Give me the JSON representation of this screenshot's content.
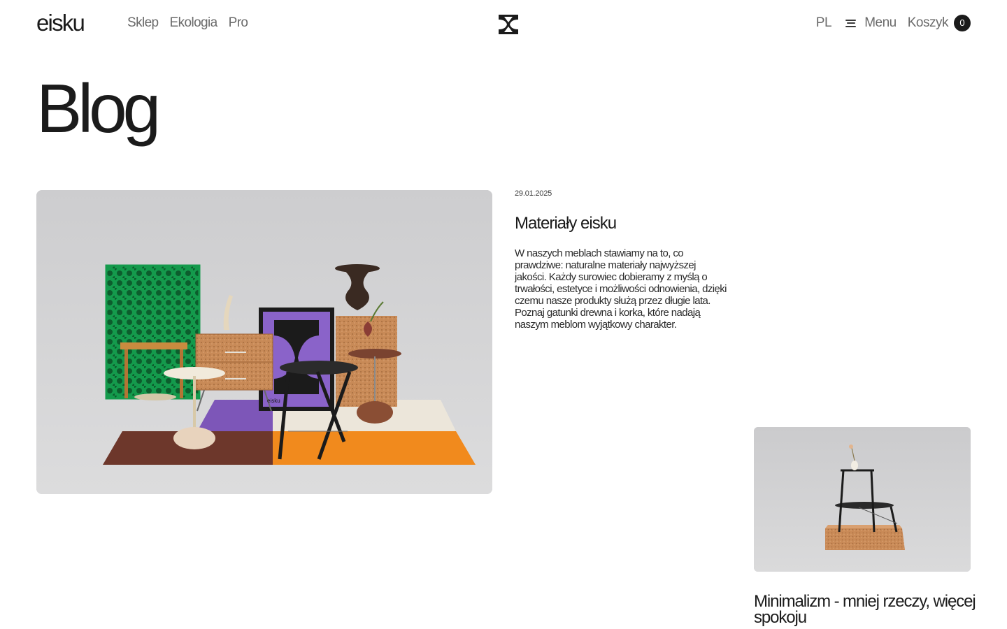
{
  "header": {
    "logo": "eisku",
    "nav": [
      "Sklep",
      "Ekologia",
      "Pro"
    ],
    "language": "PL",
    "menu_label": "Menu",
    "cart_label": "Koszyk",
    "cart_count": "0"
  },
  "page": {
    "title": "Blog"
  },
  "posts": [
    {
      "date": "29.01.2025",
      "title": "Materiały eisku",
      "excerpt": "W naszych meblach stawiamy na to, co prawdziwe: naturalne materiały najwyższej jakości. Każdy surowiec dobieramy z myślą o trwałości, estetyce i możliwości odnowienia, dzięki czemu nasze produkty służą przez długie lata. Poznaj gatunki drewna i korka, które nadają naszym meblom wyjątkowy charakter.",
      "image_label": "eisku"
    },
    {
      "title": "Minimalizm - mniej rzeczy, więcej spokoju"
    }
  ],
  "colors": {
    "text": "#1b1b1b",
    "muted": "#6b6b6b",
    "green": "#1f9a4f",
    "purple": "#8a63c9",
    "orange": "#f0861f",
    "brown": "#6b3a2a",
    "cork": "#c98a5a"
  },
  "icons": {
    "brand_mark": "eisku-hourglass-mark",
    "menu": "hamburger-icon"
  }
}
